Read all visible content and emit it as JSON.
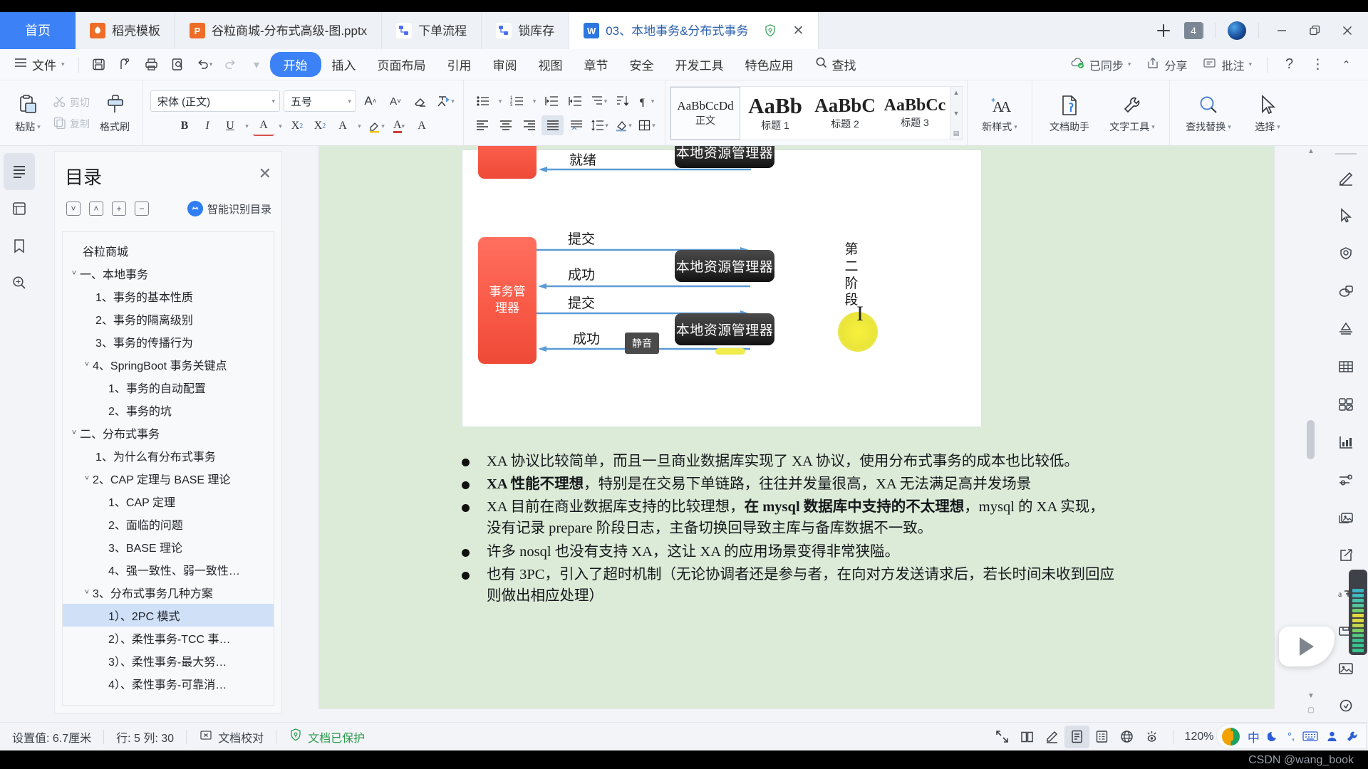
{
  "window": {
    "tabs": [
      {
        "label": "首页",
        "icon": "home-tab",
        "kind": "home"
      },
      {
        "label": "稻壳模板",
        "icon": "docer-icon",
        "kind": "docer"
      },
      {
        "label": "谷粒商城-分布式高级-图.pptx",
        "icon": "ppt-icon",
        "kind": "ppt"
      },
      {
        "label": "下单流程",
        "icon": "flowchart-icon",
        "kind": "flow"
      },
      {
        "label": "锁库存",
        "icon": "flowchart-icon",
        "kind": "flow"
      },
      {
        "label": "03、本地事务&分布式事务",
        "icon": "word-doc-icon",
        "kind": "doc",
        "active": true
      }
    ],
    "tab_shield_icon": "shield-icon",
    "tab_close_icon": "close-icon",
    "new_tab_icon": "plus-icon",
    "tab_count": "4",
    "globe_icon": "globe-icon",
    "minimize_icon": "minimize-icon",
    "restore_icon": "restore-icon",
    "close_icon": "close-icon"
  },
  "menubar": {
    "hamburger_icon": "hamburger-icon",
    "file_label": "文件",
    "quick_buttons": [
      {
        "name": "save-button",
        "icon": "save-icon"
      },
      {
        "name": "print-preview-button",
        "icon": "print-direct-icon"
      },
      {
        "name": "print-button",
        "icon": "printer-icon"
      },
      {
        "name": "print-preview2-button",
        "icon": "preview-icon"
      },
      {
        "name": "undo-button",
        "icon": "undo-icon"
      },
      {
        "name": "redo-button",
        "icon": "redo-icon"
      },
      {
        "name": "customize-button",
        "icon": "chevron-down-icon"
      }
    ],
    "tabs": [
      "开始",
      "插入",
      "页面布局",
      "引用",
      "审阅",
      "视图",
      "章节",
      "安全",
      "开发工具",
      "特色应用"
    ],
    "selected_tab": "开始",
    "search_label": "查找",
    "search_icon": "search-icon",
    "right_items": [
      {
        "label": "已同步",
        "icon": "cloud-sync-icon",
        "caret": true
      },
      {
        "label": "分享",
        "icon": "share-icon",
        "caret": false
      },
      {
        "label": "批注",
        "icon": "comment-icon",
        "caret": true
      }
    ],
    "help_icon": "help-icon",
    "more_icon": "more-vertical-icon",
    "collapse_icon": "chevron-up-icon"
  },
  "ribbon": {
    "paste_label": "粘贴",
    "paste_icon": "clipboard-icon",
    "cut_label": "剪切",
    "cut_icon": "scissors-icon",
    "copy_label": "复制",
    "copy_icon": "copy-icon",
    "format_painter_label": "格式刷",
    "format_painter_icon": "format-painter-icon",
    "font_family": "宋体 (正文)",
    "font_size": "五号",
    "font_buttons": [
      {
        "name": "grow-font-button",
        "glyph": "A⁺"
      },
      {
        "name": "shrink-font-button",
        "glyph": "A⁻"
      },
      {
        "name": "clear-format-button",
        "glyph": "eraser"
      },
      {
        "name": "pinyin-guide-button",
        "glyph": "拼"
      }
    ],
    "format_buttons": [
      {
        "name": "bold-button",
        "glyph": "B"
      },
      {
        "name": "italic-button",
        "glyph": "I"
      },
      {
        "name": "underline-button",
        "glyph": "U"
      },
      {
        "name": "strikethrough-button",
        "glyph": "A"
      },
      {
        "name": "superscript-button",
        "glyph": "X2"
      },
      {
        "name": "subscript-button",
        "glyph": "X2"
      },
      {
        "name": "text-effect-button",
        "glyph": "A"
      },
      {
        "name": "highlight-button",
        "glyph": "highlighter"
      },
      {
        "name": "font-color-button",
        "glyph": "A"
      },
      {
        "name": "char-border-button",
        "glyph": "A"
      }
    ],
    "paragraph_buttons": [
      {
        "name": "bullets-button",
        "icon": "bullet-list-icon"
      },
      {
        "name": "numbering-button",
        "icon": "numbered-list-icon"
      },
      {
        "name": "decrease-indent-button",
        "icon": "outdent-icon"
      },
      {
        "name": "increase-indent-button",
        "icon": "indent-icon"
      },
      {
        "name": "multilevel-list-button",
        "icon": "multilevel-list-icon"
      },
      {
        "name": "sort-button",
        "icon": "sort-icon"
      },
      {
        "name": "show-marks-button",
        "icon": "pilcrow-icon"
      },
      {
        "name": "align-left-button",
        "icon": "align-left-icon"
      },
      {
        "name": "align-center-button",
        "icon": "align-center-icon"
      },
      {
        "name": "align-right-button",
        "icon": "align-right-icon"
      },
      {
        "name": "justify-button",
        "icon": "align-justify-icon"
      },
      {
        "name": "distribute-button",
        "icon": "distribute-icon"
      },
      {
        "name": "line-spacing-button",
        "icon": "line-spacing-icon"
      },
      {
        "name": "shading-button",
        "icon": "shading-icon"
      },
      {
        "name": "borders-button",
        "icon": "borders-icon"
      }
    ],
    "styles": [
      {
        "preview": "AaBbCcDd",
        "name": "正文",
        "size": 17,
        "selected": true
      },
      {
        "preview": "AaBb",
        "name": "标题 1",
        "size": 30
      },
      {
        "preview": "AaBbC",
        "name": "标题 2",
        "size": 26
      },
      {
        "preview": "AaBbCc",
        "name": "标题 3",
        "size": 23
      }
    ],
    "right_tools": [
      {
        "label": "新样式",
        "icon": "new-style-icon",
        "caret": true
      },
      {
        "label": "文档助手",
        "icon": "doc-assistant-icon",
        "caret": false
      },
      {
        "label": "文字工具",
        "icon": "text-tool-icon",
        "caret": true
      },
      {
        "label": "查找替换",
        "icon": "search-icon",
        "caret": true
      },
      {
        "label": "选择",
        "icon": "cursor-select-icon",
        "caret": true
      }
    ]
  },
  "left_rail": [
    {
      "name": "outline-panel-button",
      "icon": "list-icon",
      "active": true
    },
    {
      "name": "thumbnails-button",
      "icon": "thumbnail-icon"
    },
    {
      "name": "bookmark-button",
      "icon": "bookmark-icon"
    },
    {
      "name": "find-panel-button",
      "icon": "search-doc-icon"
    }
  ],
  "toc": {
    "title": "目录",
    "close_icon": "close-icon",
    "tools": [
      {
        "name": "expand-all-button",
        "icon": "chevron-down-box-icon"
      },
      {
        "name": "collapse-all-button",
        "icon": "chevron-up-box-icon"
      },
      {
        "name": "expand-level-button",
        "icon": "plus-box-icon"
      },
      {
        "name": "collapse-level-button",
        "icon": "minus-box-icon"
      }
    ],
    "ai_label": "智能识别目录",
    "ai_icon": "ai-icon",
    "items": [
      {
        "label": "谷粒商城",
        "indent": 1,
        "chev": ""
      },
      {
        "label": "一、本地事务",
        "indent": 0,
        "chev": "v"
      },
      {
        "label": "1、事务的基本性质",
        "indent": 2,
        "chev": ""
      },
      {
        "label": "2、事务的隔离级别",
        "indent": 2,
        "chev": ""
      },
      {
        "label": "3、事务的传播行为",
        "indent": 2,
        "chev": ""
      },
      {
        "label": "4、SpringBoot 事务关键点",
        "indent": 1,
        "chev": "v"
      },
      {
        "label": "1、事务的自动配置",
        "indent": 3,
        "chev": ""
      },
      {
        "label": "2、事务的坑",
        "indent": 3,
        "chev": ""
      },
      {
        "label": "二、分布式事务",
        "indent": 0,
        "chev": "v"
      },
      {
        "label": "1、为什么有分布式事务",
        "indent": 2,
        "chev": ""
      },
      {
        "label": "2、CAP 定理与 BASE 理论",
        "indent": 1,
        "chev": "v"
      },
      {
        "label": "1、CAP 定理",
        "indent": 3,
        "chev": ""
      },
      {
        "label": "2、面临的问题",
        "indent": 3,
        "chev": ""
      },
      {
        "label": "3、BASE 理论",
        "indent": 3,
        "chev": ""
      },
      {
        "label": "4、强一致性、弱一致性…",
        "indent": 3,
        "chev": ""
      },
      {
        "label": "3、分布式事务几种方案",
        "indent": 1,
        "chev": "v"
      },
      {
        "label": "1）、2PC 模式",
        "indent": 3,
        "chev": "",
        "selected": true
      },
      {
        "label": "2）、柔性事务-TCC 事…",
        "indent": 3,
        "chev": ""
      },
      {
        "label": "3）、柔性事务-最大努…",
        "indent": 3,
        "chev": ""
      },
      {
        "label": "4）、柔性事务-可靠消…",
        "indent": 3,
        "chev": ""
      }
    ]
  },
  "slide": {
    "transaction_manager_label": "事务管\n理器",
    "top_manager_label": "本地资源管理器",
    "resource_managers": [
      "本地资源管理器",
      "本地资源管理器",
      "本地资源管理器"
    ],
    "arrow_labels": [
      "就绪",
      "提交",
      "成功",
      "提交",
      "成功"
    ],
    "phase_label": "第二阶段",
    "mute_tooltip": "静音"
  },
  "document": {
    "bullets": [
      {
        "segments": [
          {
            "t": "XA 协议比较简单，而且一旦商业数据库实现了 XA 协议，使用分布式事务的成本也比较低。",
            "b": false
          }
        ]
      },
      {
        "segments": [
          {
            "t": "XA 性能不理想",
            "b": true
          },
          {
            "t": "，特别是在交易下单链路，往往并发量很高，XA 无法满足高并发场景",
            "b": false
          }
        ]
      },
      {
        "segments": [
          {
            "t": "XA 目前在商业数据库支持的比较理想，",
            "b": false
          },
          {
            "t": "在 mysql 数据库中支持的不太理想",
            "b": true
          },
          {
            "t": "，mysql 的 XA 实现，没有记录 prepare 阶段日志，主备切换回导致主库与备库数据不一致。",
            "b": false
          }
        ]
      },
      {
        "segments": [
          {
            "t": "许多 nosql 也没有支持 XA，这让 XA 的应用场景变得非常狭隘。",
            "b": false
          }
        ]
      },
      {
        "segments": [
          {
            "t": "也有 3PC，引入了超时机制（无论协调者还是参与者，在向对方发送请求后，若长时间未收到回应则做出相应处理）",
            "b": false
          }
        ]
      }
    ]
  },
  "right_rail": [
    {
      "name": "ink-tool-button",
      "icon": "pen-icon"
    },
    {
      "name": "select-tool-button",
      "icon": "cursor-icon"
    },
    {
      "name": "shape-tool-button",
      "icon": "badge-icon"
    },
    {
      "name": "shapes-button",
      "icon": "shapes-icon"
    },
    {
      "name": "smartart-button",
      "icon": "pyramid-icon"
    },
    {
      "name": "table-button",
      "icon": "table-icon"
    },
    {
      "name": "layout-button",
      "icon": "grid-icon"
    },
    {
      "name": "chart-button",
      "icon": "bar-chart-icon"
    },
    {
      "name": "settings-button",
      "icon": "sliders-icon"
    },
    {
      "name": "gallery-button",
      "icon": "images-icon"
    },
    {
      "name": "export-button",
      "icon": "export-icon"
    },
    {
      "name": "translate-button",
      "icon": "translate-icon"
    },
    {
      "name": "archive-button",
      "icon": "inbox-icon"
    },
    {
      "name": "picture-button",
      "icon": "picture-icon"
    },
    {
      "name": "stamp-button",
      "icon": "stamp-icon"
    }
  ],
  "status": {
    "setting_value": "设置值: 6.7厘米",
    "row_col": "行: 5  列: 30",
    "proofread_label": "文档校对",
    "proofread_icon": "proofread-icon",
    "protected_label": "文档已保护",
    "protected_icon": "shield-icon",
    "view_buttons": [
      {
        "name": "fullscreen-button",
        "icon": "fullscreen-icon"
      },
      {
        "name": "reading-view-button",
        "icon": "book-icon"
      },
      {
        "name": "ink-view-button",
        "icon": "pen-icon"
      },
      {
        "name": "page-view-button",
        "icon": "page-icon",
        "active": true
      },
      {
        "name": "outline-view-button",
        "icon": "outline-icon"
      },
      {
        "name": "web-view-button",
        "icon": "globe-icon"
      },
      {
        "name": "eye-protect-button",
        "icon": "eye-icon"
      }
    ],
    "zoom_label": "120%",
    "zoom_minus_icon": "minus-icon"
  },
  "ime": {
    "logo": "sogou-logo",
    "mode_label": "中",
    "items": [
      {
        "name": "ime-mode-chinese",
        "glyph": "中"
      },
      {
        "name": "ime-moon-icon",
        "glyph": "moon"
      },
      {
        "name": "ime-punctuation-icon",
        "glyph": "°,"
      },
      {
        "name": "ime-keyboard-icon",
        "glyph": "keyboard"
      },
      {
        "name": "ime-user-icon",
        "glyph": "user"
      },
      {
        "name": "ime-tools-icon",
        "glyph": "wrench"
      }
    ]
  },
  "watermark": "CSDN @wang_book",
  "colors": {
    "accent": "#3c81f6",
    "tab_active_text": "#2a5fae",
    "slide_bg": "#dcebd7",
    "tm_red": "#f95a48",
    "rm_black": "#2f2f2f",
    "arrow_blue": "#5b9bd5",
    "selection": "#cfe0f7",
    "green_status": "#2c9b4e"
  }
}
